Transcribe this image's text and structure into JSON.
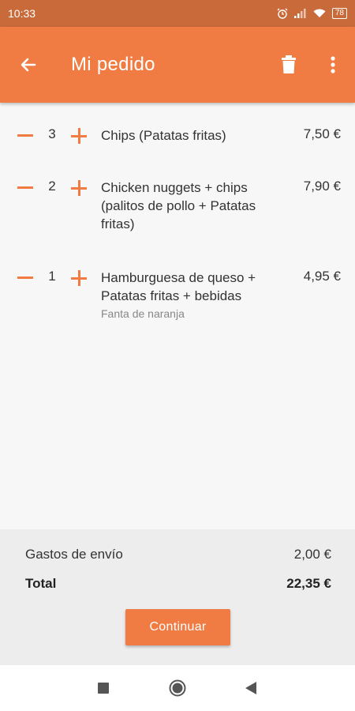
{
  "status_bar": {
    "time": "10:33",
    "battery": "78"
  },
  "app_bar": {
    "title": "Mi pedido"
  },
  "colors": {
    "accent": "#f07c43",
    "status_bar": "#c96a3a"
  },
  "items": [
    {
      "qty": "3",
      "name": "Chips (Patatas fritas)",
      "note": "",
      "price": "7,50 €"
    },
    {
      "qty": "2",
      "name": "Chicken nuggets + chips (palitos de pollo + Patatas fritas)",
      "note": "",
      "price": "7,90 €"
    },
    {
      "qty": "1",
      "name": "Hamburguesa de queso + Patatas fritas + bebidas",
      "note": "Fanta de naranja",
      "price": "4,95 €"
    }
  ],
  "summary": {
    "shipping_label": "Gastos de envío",
    "shipping_value": "2,00 €",
    "total_label": "Total",
    "total_value": "22,35 €",
    "continue_label": "Continuar"
  },
  "icons": {
    "back": "arrow-back-icon",
    "delete": "trash-icon",
    "more": "more-vert-icon",
    "nav_recents": "square-icon",
    "nav_home": "circle-icon",
    "nav_back": "triangle-back-icon"
  }
}
